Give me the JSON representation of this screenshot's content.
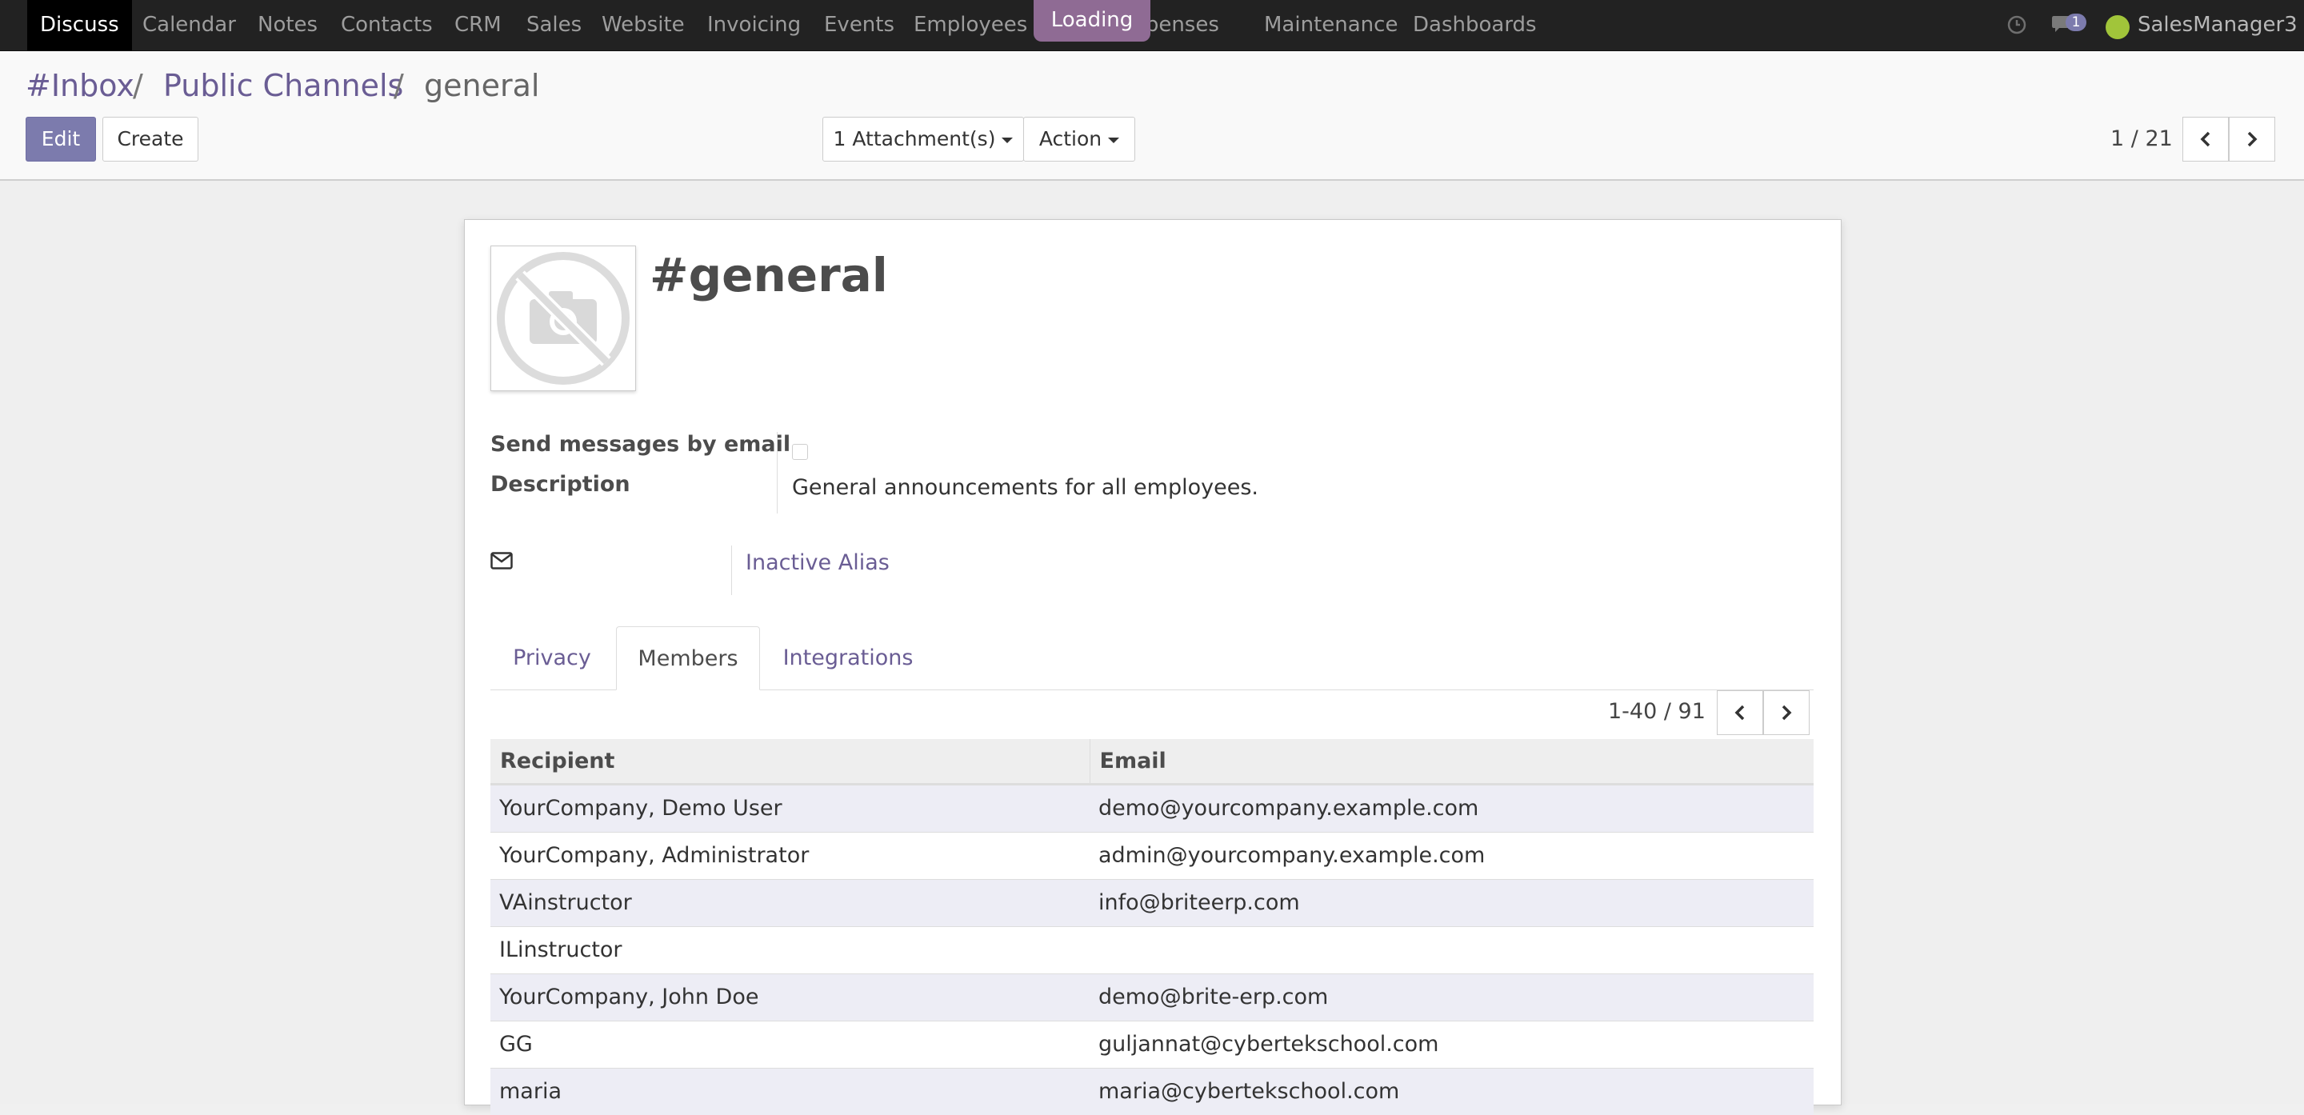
{
  "navbar": {
    "menu": [
      "Discuss",
      "Calendar",
      "Notes",
      "Contacts",
      "CRM",
      "Sales",
      "Website",
      "Invoicing",
      "Events",
      "Employees",
      "Expenses",
      "Maintenance",
      "Dashboards"
    ],
    "loading": "Loading",
    "message_count": "1",
    "user": "SalesManager3"
  },
  "breadcrumb": {
    "items": [
      "#Inbox",
      "Public Channels",
      "general"
    ],
    "separator": "/"
  },
  "toolbar": {
    "edit": "Edit",
    "create": "Create",
    "attachments": "1 Attachment(s)",
    "action": "Action"
  },
  "record_pager": {
    "value": "1 / 21"
  },
  "form": {
    "title": "#general",
    "send_by_email_label": "Send messages by email",
    "send_by_email_checked": false,
    "description_label": "Description",
    "description": "General announcements for all employees.",
    "alias": "Inactive Alias"
  },
  "tabs": [
    {
      "label": "Privacy",
      "active": false
    },
    {
      "label": "Members",
      "active": true
    },
    {
      "label": "Integrations",
      "active": false
    }
  ],
  "members_pager": {
    "value": "1-40 / 91"
  },
  "members_table": {
    "columns": [
      "Recipient",
      "Email"
    ],
    "rows": [
      {
        "recipient": "YourCompany, Demo User",
        "email": "demo@yourcompany.example.com"
      },
      {
        "recipient": "YourCompany, Administrator",
        "email": "admin@yourcompany.example.com"
      },
      {
        "recipient": "VAinstructor",
        "email": "info@briteerp.com"
      },
      {
        "recipient": "ILinstructor",
        "email": ""
      },
      {
        "recipient": "YourCompany, John Doe",
        "email": "demo@brite-erp.com"
      },
      {
        "recipient": "GG",
        "email": "guljannat@cybertekschool.com"
      },
      {
        "recipient": "maria",
        "email": "maria@cybertekschool.com"
      }
    ]
  },
  "colors": {
    "navbar_bg": "#222222",
    "accent": "#7c7bad",
    "link": "#6a5d94",
    "loading_badge": "#8f6b94",
    "odd_row": "#ededf5"
  },
  "icons": [
    "clock-icon",
    "chat-icon",
    "envelope-icon",
    "no-image-icon",
    "chevron-left-icon",
    "chevron-right-icon",
    "caret-down-icon"
  ]
}
